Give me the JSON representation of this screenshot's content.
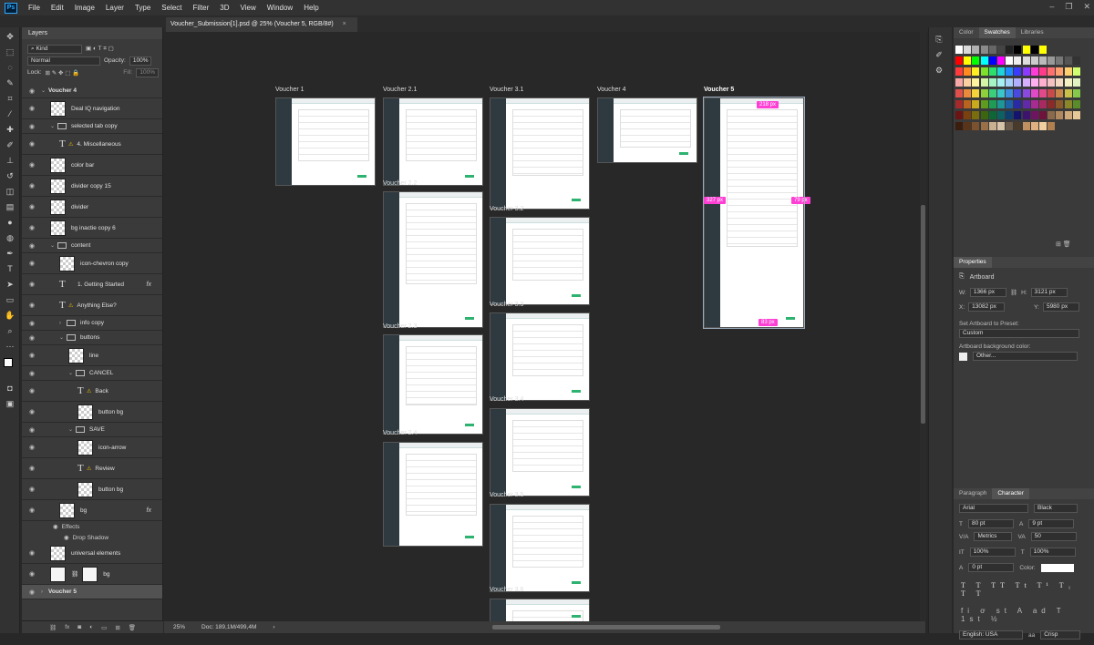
{
  "app": {
    "logo": "Ps",
    "menu": [
      "File",
      "Edit",
      "Image",
      "Layer",
      "Type",
      "Select",
      "Filter",
      "3D",
      "View",
      "Window",
      "Help"
    ],
    "win_controls": [
      "–",
      "❐",
      "✕"
    ]
  },
  "document_tab": {
    "title": "Voucher_Submission[1].psd @ 25% (Voucher 5, RGB/8#)",
    "close": "×"
  },
  "layers_panel": {
    "tab": "Layers",
    "filter_kind": "Kind",
    "blend_mode": "Normal",
    "opacity_label": "Opacity:",
    "opacity": "100%",
    "lock_label": "Lock:",
    "fill_label": "Fill:",
    "fill": "100%",
    "layers": [
      {
        "name": "Voucher 4",
        "kind": "artboard",
        "expanded": true
      },
      {
        "name": "Deal IQ navigation",
        "kind": "image"
      },
      {
        "name": "selected tab copy",
        "kind": "group",
        "expanded": true
      },
      {
        "name": "4. Miscellaneous",
        "kind": "text",
        "warn": true
      },
      {
        "name": "color bar",
        "kind": "image"
      },
      {
        "name": "divider copy 15",
        "kind": "image"
      },
      {
        "name": "divider",
        "kind": "image"
      },
      {
        "name": "bg inactie copy 6",
        "kind": "image"
      },
      {
        "name": "content",
        "kind": "group",
        "expanded": true
      },
      {
        "name": "icon-chevron copy",
        "kind": "image"
      },
      {
        "name": "1. Getting Started",
        "kind": "text",
        "fx": true
      },
      {
        "name": "Anything Else?",
        "kind": "text",
        "warn": true
      },
      {
        "name": "info copy",
        "kind": "group",
        "expanded": false
      },
      {
        "name": "buttons",
        "kind": "group",
        "expanded": true
      },
      {
        "name": "line",
        "kind": "image"
      },
      {
        "name": "CANCEL",
        "kind": "group",
        "expanded": true
      },
      {
        "name": "Back",
        "kind": "text",
        "warn": true
      },
      {
        "name": "button bg",
        "kind": "image"
      },
      {
        "name": "SAVE",
        "kind": "group",
        "expanded": true
      },
      {
        "name": "icon-arrow",
        "kind": "image"
      },
      {
        "name": "Review",
        "kind": "text",
        "warn": true
      },
      {
        "name": "button bg",
        "kind": "image"
      },
      {
        "name": "bg",
        "kind": "image",
        "fx": true
      },
      {
        "name": "universal elements",
        "kind": "smart"
      },
      {
        "name": "bg",
        "kind": "mask"
      },
      {
        "name": "Voucher 5",
        "kind": "artboard",
        "selected": true
      }
    ],
    "effects_label": "Effects",
    "drop_shadow_label": "Drop Shadow"
  },
  "canvas": {
    "artboards": [
      {
        "label": "Voucher 1"
      },
      {
        "label": "Voucher 2.1"
      },
      {
        "label": "Voucher 2.2"
      },
      {
        "label": "Voucher 2.3"
      },
      {
        "label": "Voucher 2.4"
      },
      {
        "label": "Voucher 3.1"
      },
      {
        "label": "Voucher 3.2"
      },
      {
        "label": "Voucher 3.3"
      },
      {
        "label": "Voucher 3.4"
      },
      {
        "label": "Voucher 3.5"
      },
      {
        "label": "Voucher 3.6"
      },
      {
        "label": "Voucher 4"
      },
      {
        "label": "Voucher 5"
      }
    ],
    "guides": [
      "218 px",
      "327 px",
      "79 px",
      "83 px"
    ]
  },
  "status": {
    "zoom": "25%",
    "doc": "Doc: 189,1M/499,4M"
  },
  "swatches_panel": {
    "tabs": [
      "Color",
      "Swatches",
      "Libraries"
    ],
    "active": "Swatches"
  },
  "properties": {
    "tab": "Properties",
    "type": "Artboard",
    "w_label": "W:",
    "w": "1366 px",
    "h_label": "H:",
    "h": "3121 px",
    "x_label": "X:",
    "x": "13082 px",
    "y_label": "Y:",
    "y": "5980 px",
    "preset_label": "Set Artboard to Preset:",
    "preset": "Custom",
    "bg_label": "Artboard background color:",
    "bg": "Other..."
  },
  "character": {
    "tabs": [
      "Paragraph",
      "Character"
    ],
    "active": "Character",
    "font": "Arial",
    "style": "Black",
    "size": "80 pt",
    "leading": "9 pt",
    "kerning": "Metrics",
    "tracking": "50",
    "vscale": "100%",
    "hscale": "100%",
    "baseline": "0 pt",
    "color_label": "Color:",
    "language": "English: USA",
    "aa_label": "aa",
    "aa": "Crisp"
  },
  "colors": {
    "accent": "#31a8ff",
    "guide": "#ff3fd4",
    "button_green": "#2db36f"
  }
}
